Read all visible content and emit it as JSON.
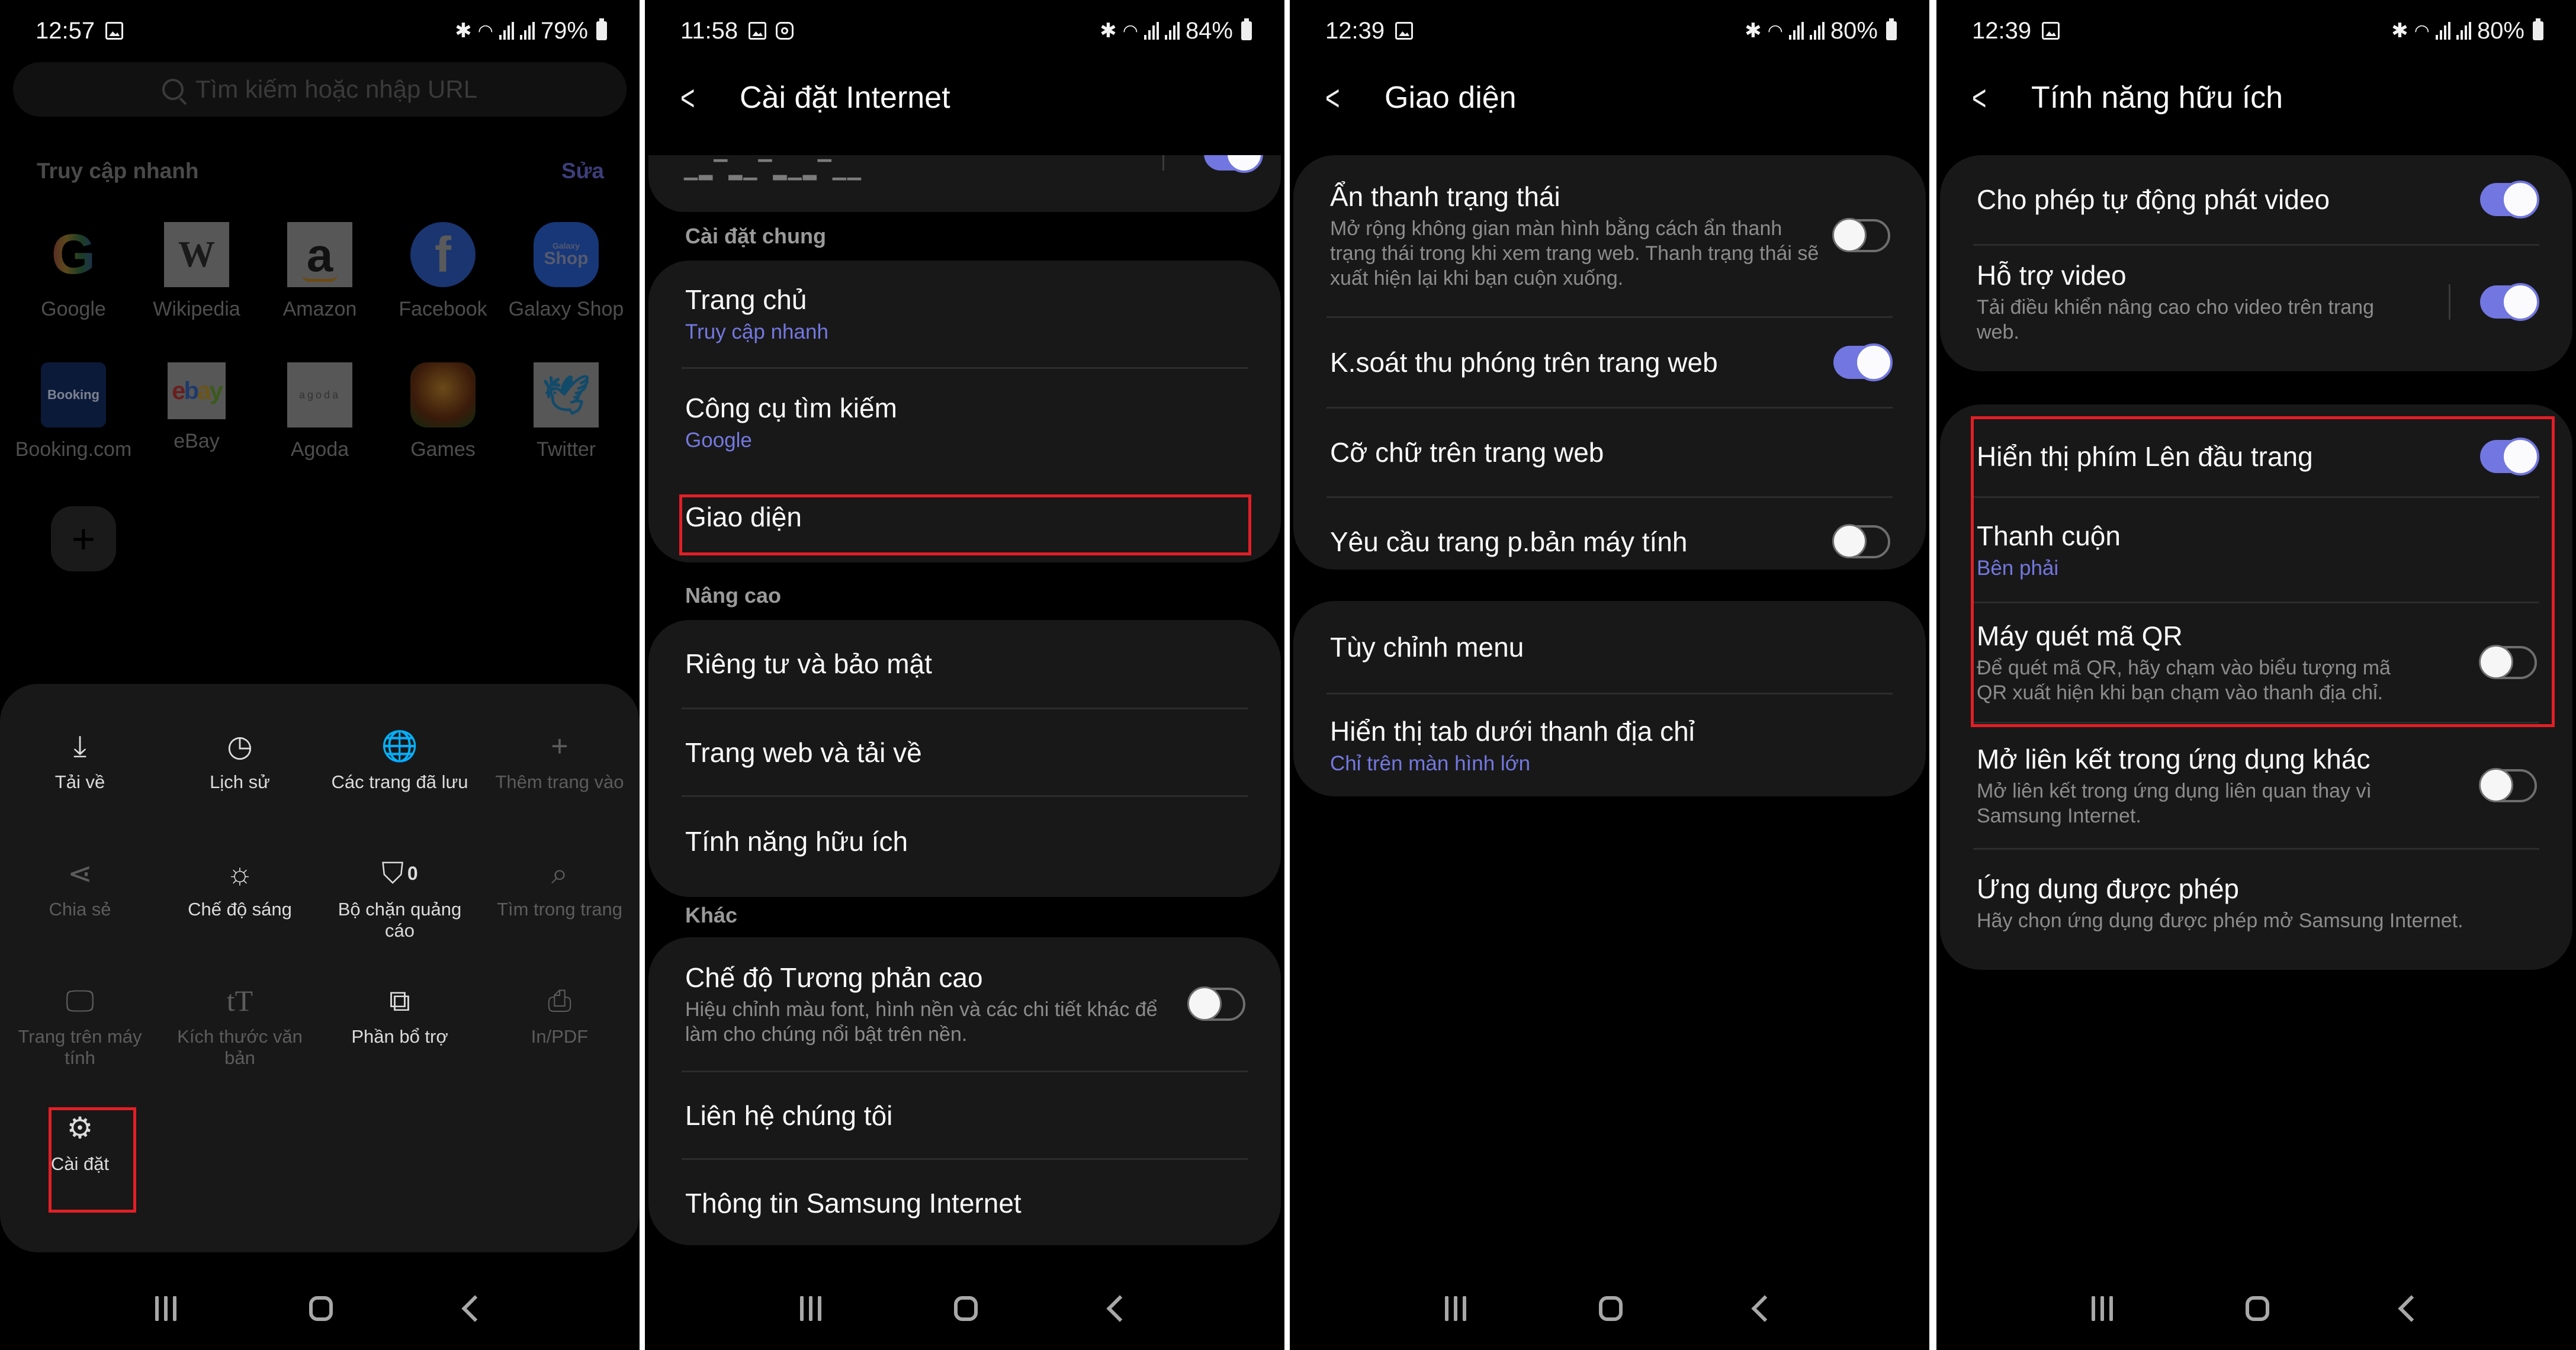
{
  "colors": {
    "accent": "#7176e0",
    "highlight": "#e21f26",
    "card": "#181818",
    "background": "#000000"
  },
  "panels": {
    "p1": {
      "status": {
        "time": "12:57",
        "battery": "79%",
        "icons": [
          "image-icon",
          "bluetooth-icon",
          "wifi-icon",
          "signal-icon",
          "signal-icon",
          "battery-charging-icon"
        ]
      },
      "search_placeholder": "Tìm kiếm hoặc nhập URL",
      "quick_access": {
        "title": "Truy cập nhanh",
        "edit": "Sửa",
        "items": [
          {
            "label": "Google",
            "icon": "google-icon"
          },
          {
            "label": "Wikipedia",
            "icon": "wikipedia-icon"
          },
          {
            "label": "Amazon",
            "icon": "amazon-icon"
          },
          {
            "label": "Facebook",
            "icon": "facebook-icon"
          },
          {
            "label": "Galaxy Shop",
            "icon": "galaxy-shop-icon"
          },
          {
            "label": "Booking.com",
            "icon": "booking-icon"
          },
          {
            "label": "eBay",
            "icon": "ebay-icon"
          },
          {
            "label": "Agoda",
            "icon": "agoda-icon"
          },
          {
            "label": "Games",
            "icon": "games-icon"
          },
          {
            "label": "Twitter",
            "icon": "twitter-icon"
          }
        ],
        "add_icon": "plus-icon"
      },
      "menu": [
        {
          "label": "Tải về",
          "icon": "download-icon",
          "enabled": true
        },
        {
          "label": "Lịch sử",
          "icon": "history-icon",
          "enabled": true
        },
        {
          "label": "Các trang đã lưu",
          "icon": "saved-pages-icon",
          "enabled": true
        },
        {
          "label": "Thêm trang vào",
          "icon": "plus-icon",
          "enabled": false
        },
        {
          "label": "Chia sẻ",
          "icon": "share-icon",
          "enabled": false
        },
        {
          "label": "Chế độ sáng",
          "icon": "light-mode-icon",
          "enabled": true
        },
        {
          "label": "Bộ chặn quảng cáo",
          "icon": "ad-blocker-icon",
          "enabled": true,
          "badge": "0"
        },
        {
          "label": "Tìm trong trang",
          "icon": "find-in-page-icon",
          "enabled": false
        },
        {
          "label": "Trang trên máy tính",
          "icon": "desktop-icon",
          "enabled": false
        },
        {
          "label": "Kích thước văn bản",
          "icon": "text-size-icon",
          "enabled": false
        },
        {
          "label": "Phần bổ trợ",
          "icon": "add-ons-icon",
          "enabled": true
        },
        {
          "label": "In/PDF",
          "icon": "print-icon",
          "enabled": false
        },
        {
          "label": "Cài đặt",
          "icon": "gear-icon",
          "enabled": true,
          "highlighted": true
        }
      ]
    },
    "p2": {
      "status": {
        "time": "11:58",
        "battery": "84%",
        "icons": [
          "image-icon",
          "instagram-icon",
          "bluetooth-icon",
          "wifi-icon",
          "signal-icon",
          "signal-icon",
          "battery-icon"
        ]
      },
      "title": "Cài đặt Internet",
      "top_partial_toggle": true,
      "sections": [
        {
          "label": "Cài đặt chung",
          "items": [
            {
              "main": "Trang chủ",
              "value": "Truy cập nhanh"
            },
            {
              "main": "Công cụ tìm kiếm",
              "value": "Google"
            },
            {
              "main": "Giao diện",
              "highlighted": true
            }
          ]
        },
        {
          "label": "Nâng cao",
          "items": [
            {
              "main": "Riêng tư và bảo mật"
            },
            {
              "main": "Trang web và tải về"
            },
            {
              "main": "Tính năng hữu ích"
            }
          ]
        },
        {
          "label": "Khác",
          "items": [
            {
              "main": "Chế độ Tương phản cao",
              "sub": "Hiệu chỉnh màu font, hình nền và các chi tiết khác để làm cho chúng nổi bật trên nền.",
              "toggle": false
            },
            {
              "main": "Liên hệ chúng tôi"
            },
            {
              "main": "Thông tin Samsung Internet"
            }
          ]
        }
      ]
    },
    "p3": {
      "status": {
        "time": "12:39",
        "battery": "80%",
        "icons": [
          "image-icon",
          "bluetooth-icon",
          "wifi-icon",
          "signal-icon",
          "signal-icon",
          "battery-icon"
        ]
      },
      "title": "Giao diện",
      "groups": [
        [
          {
            "main": "Ẩn thanh trạng thái",
            "sub": "Mở rộng không gian màn hình bằng cách ẩn thanh trạng thái trong khi xem trang web. Thanh trạng thái sẽ xuất hiện lại khi bạn cuộn xuống.",
            "toggle": false
          },
          {
            "main": "K.soát thu phóng trên trang web",
            "toggle": true
          },
          {
            "main": "Cỡ chữ trên trang web"
          },
          {
            "main": "Yêu cầu trang p.bản máy tính",
            "toggle": false
          }
        ],
        [
          {
            "main": "Tùy chỉnh menu"
          },
          {
            "main": "Hiển thị tab dưới thanh địa chỉ",
            "value": "Chỉ trên màn hình lớn"
          }
        ]
      ]
    },
    "p4": {
      "status": {
        "time": "12:39",
        "battery": "80%",
        "icons": [
          "image-icon",
          "bluetooth-icon",
          "wifi-icon",
          "signal-icon",
          "signal-icon",
          "battery-icon"
        ]
      },
      "title": "Tính năng hữu ích",
      "groups": [
        [
          {
            "main": "Cho phép tự động phát video",
            "toggle": true
          },
          {
            "main": "Hỗ trợ video",
            "sub": "Tải điều khiển nâng cao cho video trên trang web.",
            "toggle": true
          }
        ],
        [
          {
            "main": "Hiển thị phím Lên đầu trang",
            "toggle": true,
            "highlighted": true
          },
          {
            "main": "Thanh cuộn",
            "value": "Bên phải",
            "highlighted": true
          },
          {
            "main": "Máy quét mã QR",
            "sub": "Để quét mã QR, hãy chạm vào biểu tượng mã QR xuất hiện khi bạn chạm vào thanh địa chỉ.",
            "toggle": false,
            "highlighted": true
          },
          {
            "main": "Mở liên kết trong ứng dụng khác",
            "sub": "Mở liên kết trong ứng dụng liên quan thay vì Samsung Internet.",
            "toggle": false
          },
          {
            "main": "Ứng dụng được phép",
            "sub": "Hãy chọn ứng dụng được phép mở Samsung Internet."
          }
        ]
      ]
    }
  },
  "navbar": {
    "icons": [
      "recent-apps-icon",
      "home-icon",
      "back-icon"
    ]
  }
}
